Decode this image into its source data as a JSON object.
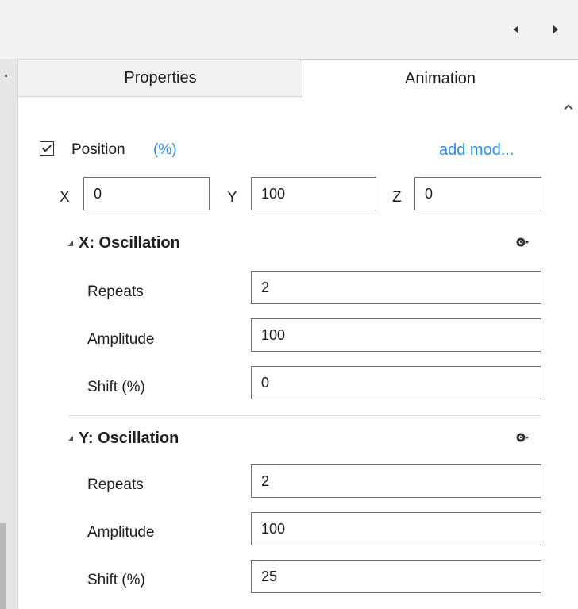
{
  "tabs": {
    "properties": "Properties",
    "animation": "Animation"
  },
  "position": {
    "label": "Position",
    "unit": "(%)",
    "checked": true,
    "add_modifier": "add mod...",
    "x_label": "X",
    "x_value": "0",
    "y_label": "Y",
    "y_value": "100",
    "z_label": "Z",
    "z_value": "0"
  },
  "x_oscillation": {
    "title": "X: Oscillation",
    "repeats_label": "Repeats",
    "repeats_value": "2",
    "amplitude_label": "Amplitude",
    "amplitude_value": "100",
    "shift_label": "Shift (%)",
    "shift_value": "0"
  },
  "y_oscillation": {
    "title": "Y: Oscillation",
    "repeats_label": "Repeats",
    "repeats_value": "2",
    "amplitude_label": "Amplitude",
    "amplitude_value": "100",
    "shift_label": "Shift (%)",
    "shift_value": "25"
  },
  "icons": {
    "nav_left": "chevron-left-icon",
    "nav_right": "chevron-right-icon",
    "scroll_up": "scroll-up-icon",
    "collapse": "collapse-triangle-icon",
    "settings": "gear-dropdown-icon"
  },
  "colors": {
    "link": "#2d8ceb",
    "panel": "#ffffff",
    "chrome": "#f2f2f2"
  }
}
